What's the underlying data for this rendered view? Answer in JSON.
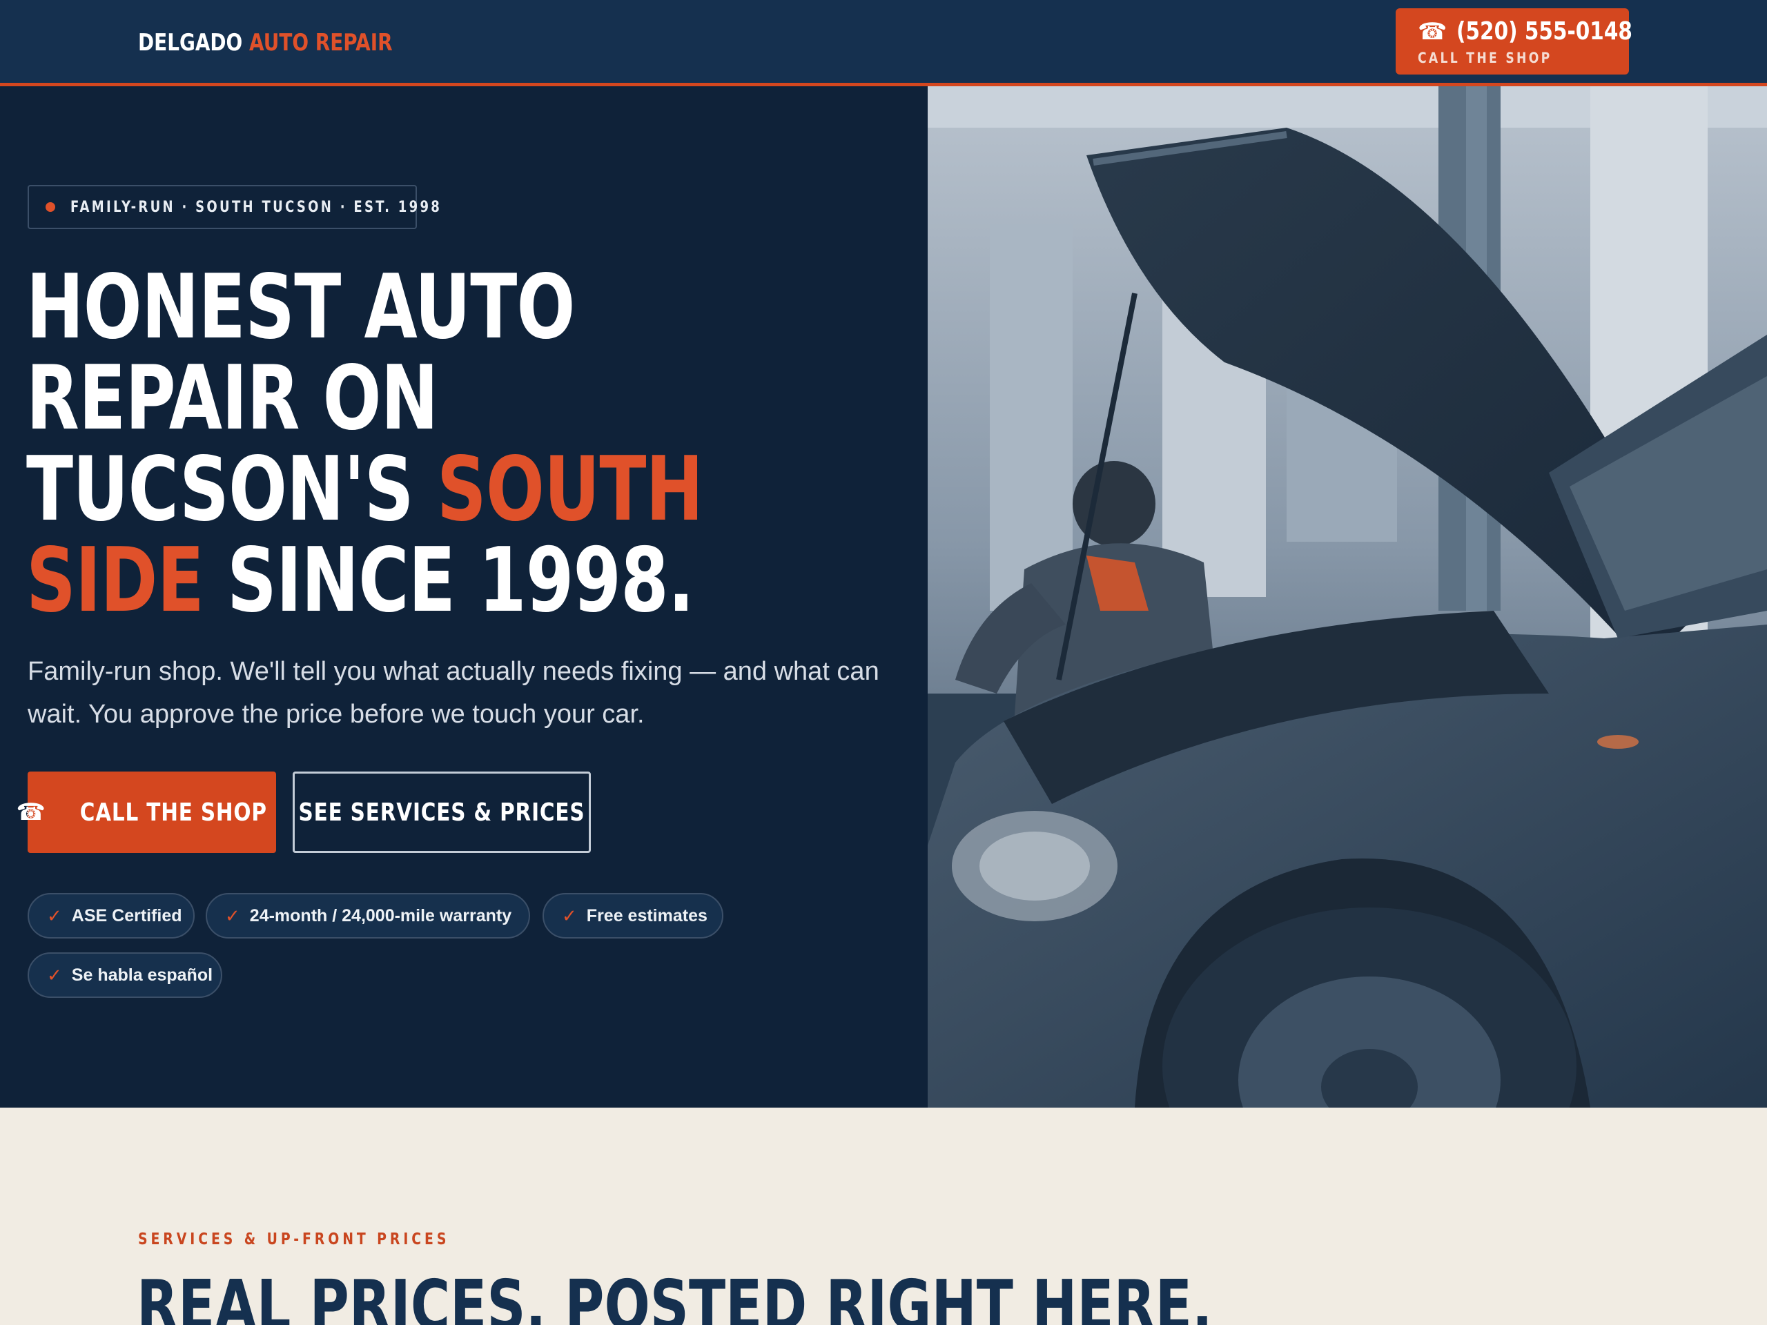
{
  "header": {
    "logo_primary": "DELGADO",
    "logo_accent": "AUTO REPAIR",
    "phone_icon": "☎",
    "phone_number": "(520) 555-0148",
    "phone_caption": "CALL THE SHOP"
  },
  "hero": {
    "eyebrow": "FAMILY-RUN · SOUTH TUCSON · EST. 1998",
    "headline": {
      "line1": "HONEST AUTO",
      "line2": "REPAIR ON",
      "line3_white": "TUCSON'S ",
      "line3_orange": "SOUTH",
      "line4_orange": "SIDE",
      "line4_white": " SINCE 1998."
    },
    "lede": "Family-run shop. We'll tell you what actually needs fixing — and what can wait. You approve the price before we touch your car.",
    "cta_primary": "CALL THE SHOP",
    "cta_secondary": "SEE SERVICES & PRICES",
    "badges": [
      "ASE Certified",
      "24-month / 24,000-mile warranty",
      "Free estimates",
      "Se habla español"
    ],
    "check_glyph": "✓"
  },
  "services": {
    "kicker": "SERVICES & UP-FRONT PRICES",
    "title": "REAL PRICES, POSTED RIGHT HERE."
  },
  "colors": {
    "navy": "#0f2239",
    "header_navy": "#15304f",
    "accent_orange": "#d4471f",
    "cream": "#f1ece3"
  }
}
